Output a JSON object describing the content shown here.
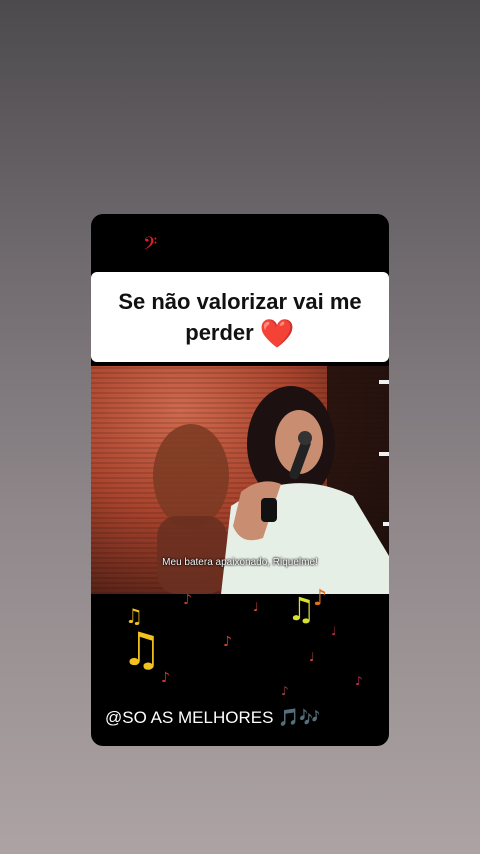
{
  "caption": {
    "line1": "Se não valorizar vai me",
    "line2": "perder",
    "emoji": "❤️"
  },
  "video": {
    "subtitle": "Meu batera apaixonado, Riquelme!"
  },
  "footer": {
    "handle": "@SO AS MELHORES",
    "emoji": "🎵🎶"
  },
  "icons": [
    "music-note-icon",
    "heart-icon",
    "bass-clef-icon"
  ]
}
